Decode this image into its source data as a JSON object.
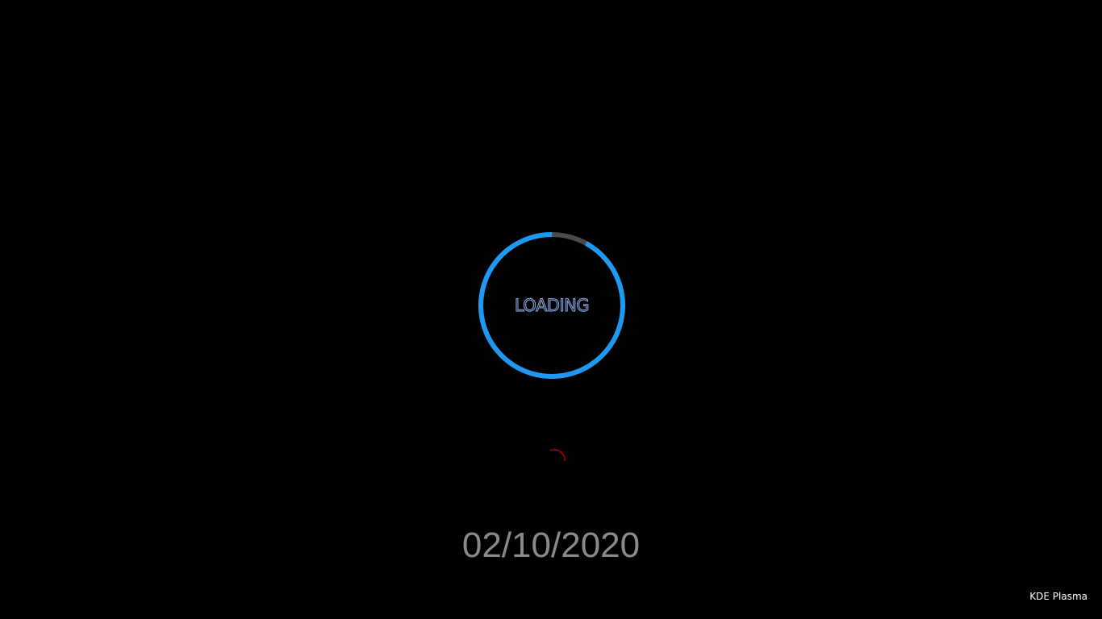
{
  "splash": {
    "loading_text": "LOADING",
    "progress": 0.92,
    "ring_color": "#1d99f3",
    "ring_track_color": "#4a4a4a",
    "spinner_color": "#8b0000"
  },
  "date": "02/10/2020",
  "branding": {
    "label": "KDE Plasma"
  }
}
